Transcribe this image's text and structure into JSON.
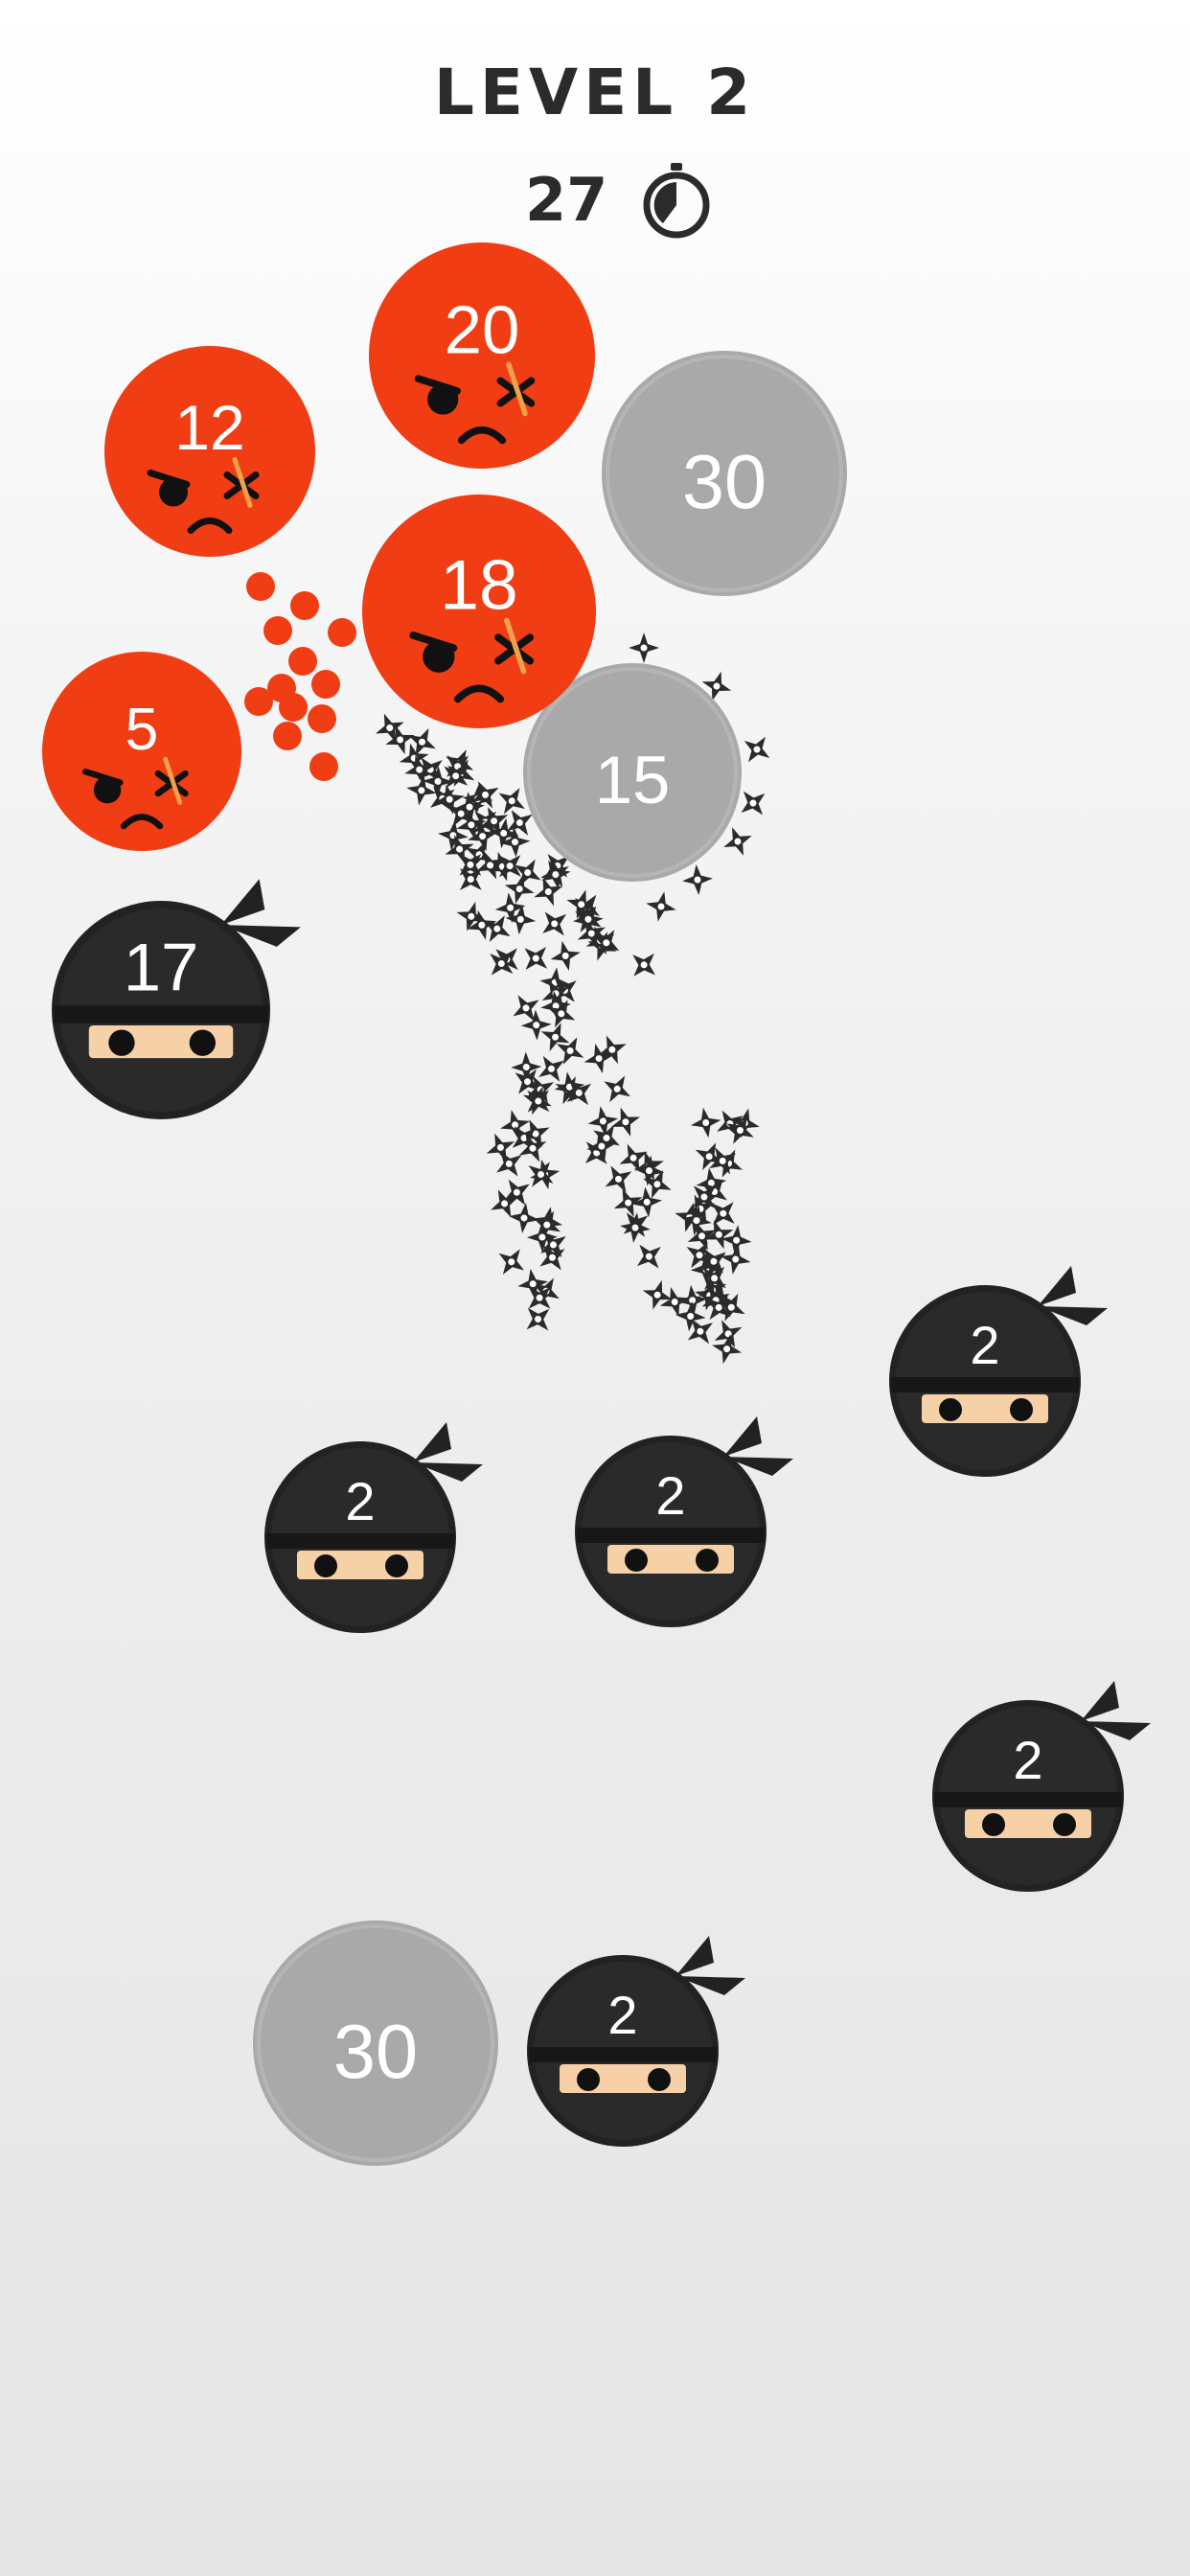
{
  "header": {
    "level_title": "LEVEL 2",
    "timer": "27",
    "timer_icon": "stopwatch-icon"
  },
  "colors": {
    "enemy_red": "#f03d14",
    "blocker_gray": "#a9a9a9",
    "ninja_black": "#222222",
    "ninja_skin": "#f6d1a8",
    "shuriken": "#2b2b2b"
  },
  "enemies": [
    {
      "value": "12",
      "icon": "angry-face-icon"
    },
    {
      "value": "20",
      "icon": "angry-face-icon"
    },
    {
      "value": "18",
      "icon": "angry-face-icon"
    },
    {
      "value": "5",
      "icon": "angry-face-icon"
    }
  ],
  "blockers": [
    {
      "value": "30"
    },
    {
      "value": "15"
    },
    {
      "value": "30"
    }
  ],
  "ninjas": [
    {
      "value": "17",
      "icon": "ninja-icon"
    },
    {
      "value": "2",
      "icon": "ninja-icon"
    },
    {
      "value": "2",
      "icon": "ninja-icon"
    },
    {
      "value": "2",
      "icon": "ninja-icon"
    },
    {
      "value": "2",
      "icon": "ninja-icon"
    },
    {
      "value": "2",
      "icon": "ninja-icon"
    }
  ]
}
